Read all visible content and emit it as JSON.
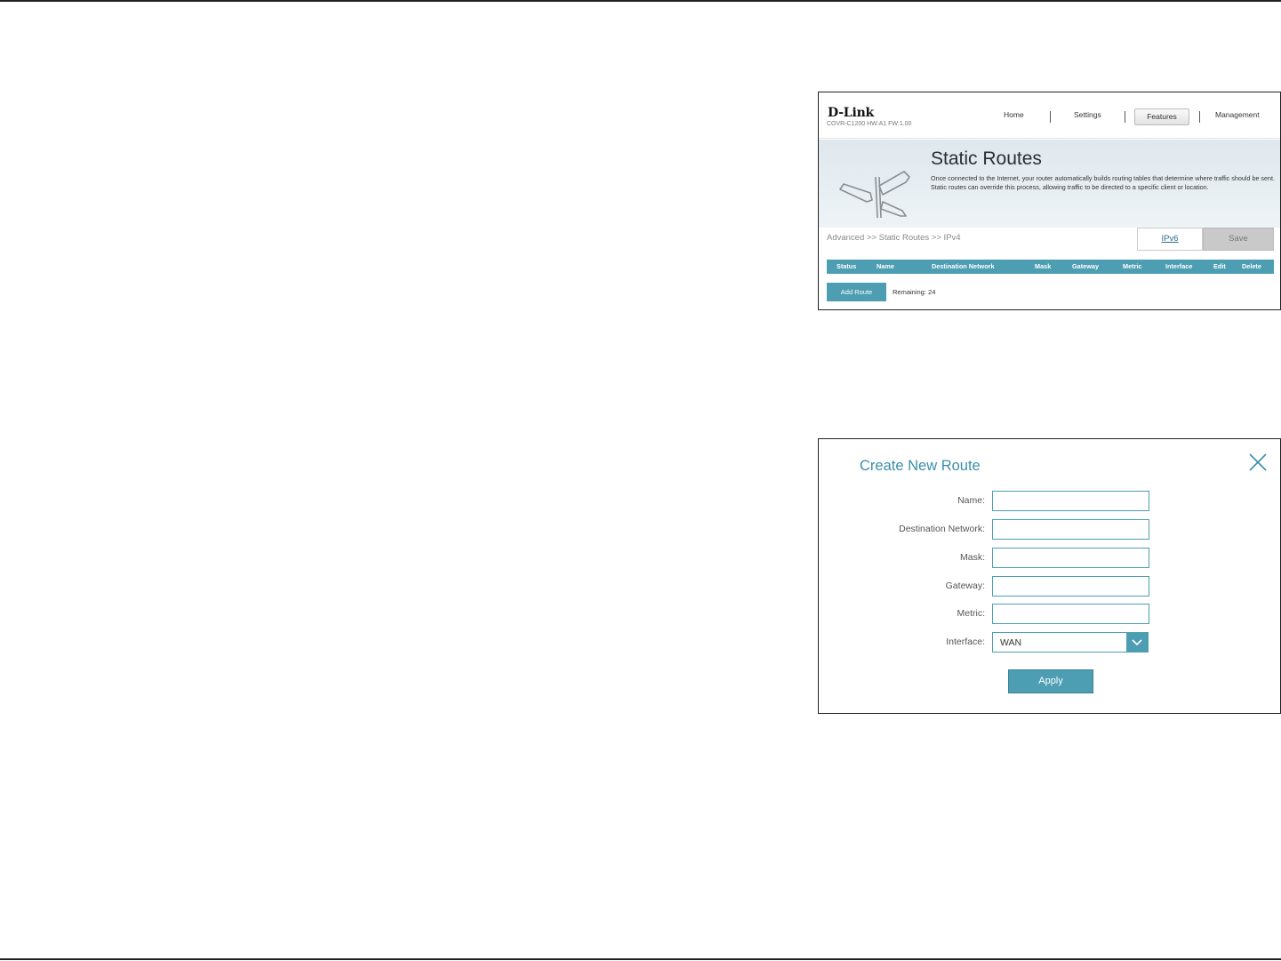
{
  "header": {
    "brand": "D-Link",
    "firmware": "COVR-C1200 HW:A1 FW:1.00",
    "nav": [
      {
        "label": "Home"
      },
      {
        "label": "Settings"
      },
      {
        "label": "Features",
        "active": true
      },
      {
        "label": "Management"
      }
    ]
  },
  "hero": {
    "title": "Static Routes",
    "description": "Once connected to the Internet, your router automatically builds routing tables that determine where traffic should be sent. Static routes can override this process, allowing traffic to be directed to a specific client or location.",
    "icon": "signpost-icon"
  },
  "breadcrumb": "Advanced >> Static Routes >> IPv4",
  "actions": {
    "ipv6_label": "IPv6",
    "save_label": "Save"
  },
  "table": {
    "columns": [
      "Status",
      "Name",
      "Destination Network",
      "Mask",
      "Gateway",
      "Metric",
      "Interface",
      "Edit",
      "Delete"
    ],
    "rows": []
  },
  "add_route": {
    "label": "Add Route",
    "remaining": "Remaining: 24"
  },
  "dialog": {
    "title": "Create New Route",
    "close_icon": "close-icon",
    "fields": {
      "name": {
        "label": "Name:",
        "value": ""
      },
      "destination": {
        "label": "Destination Network:",
        "value": ""
      },
      "mask": {
        "label": "Mask:",
        "value": ""
      },
      "gateway": {
        "label": "Gateway:",
        "value": ""
      },
      "metric": {
        "label": "Metric:",
        "value": ""
      },
      "interface": {
        "label": "Interface:",
        "value": "WAN"
      }
    },
    "apply_label": "Apply"
  },
  "colors": {
    "accent": "#4d9eb3",
    "title_accent": "#3a8ea8",
    "save_disabled": "#c9c9c9"
  }
}
